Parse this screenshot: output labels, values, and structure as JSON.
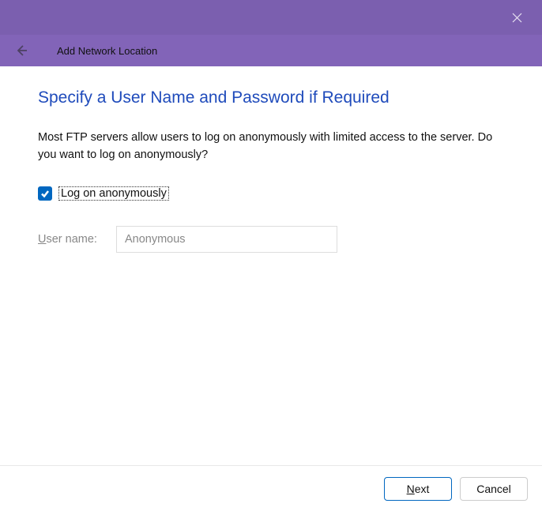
{
  "header": {
    "title": "Add Network Location"
  },
  "page": {
    "title": "Specify a User Name and Password if Required",
    "description": "Most FTP servers allow users to log on anonymously with limited access to the server.  Do you want to log on anonymously?"
  },
  "form": {
    "anonymous_checkbox_label": "Log on anonymously",
    "anonymous_checked": true,
    "username_label_prefix": "U",
    "username_label_rest": "ser name:",
    "username_value": "Anonymous"
  },
  "buttons": {
    "next_prefix": "N",
    "next_rest": "ext",
    "cancel": "Cancel"
  }
}
